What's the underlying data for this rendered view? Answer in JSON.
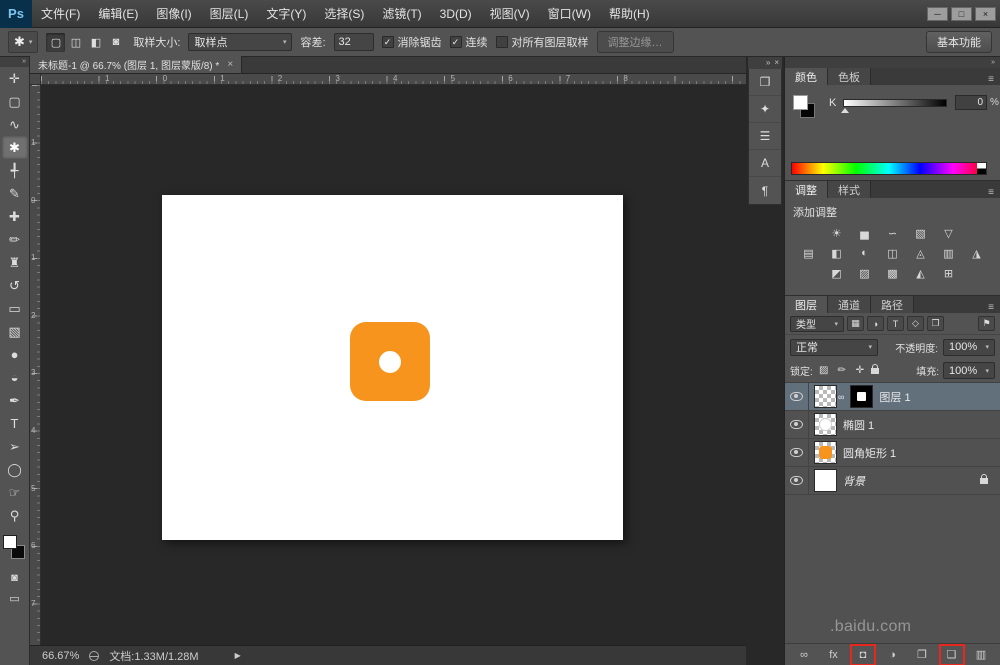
{
  "glyphs": {
    "dropdown": "▾",
    "check": "✓",
    "collapse": "»",
    "close": "×",
    "menu": "≡",
    "link": "∞",
    "arrow": "▶"
  },
  "colors": {
    "accent": "#f7941d",
    "selected_layer": "#62707c"
  },
  "menu_bar": {
    "logo": "Ps",
    "items": [
      "文件(F)",
      "编辑(E)",
      "图像(I)",
      "图层(L)",
      "文字(Y)",
      "选择(S)",
      "滤镜(T)",
      "3D(D)",
      "视图(V)",
      "窗口(W)",
      "帮助(H)"
    ],
    "minimize": "─",
    "maximize": "□",
    "close": "×"
  },
  "options_bar": {
    "tool_glyph": "✱",
    "mode_icons": [
      "▢",
      "◫",
      "◧",
      "◙"
    ],
    "sample_size_label": "取样大小:",
    "sample_size_value": "取样点",
    "tolerance_label": "容差:",
    "tolerance_value": "32",
    "anti_alias_label": "消除锯齿",
    "contiguous_label": "连续",
    "sample_all_label": "对所有图层取样",
    "refine_edge_label": "调整边缘…",
    "workspace_label": "基本功能"
  },
  "document_tab": {
    "title": "未标题-1 @ 66.7% (图层 1, 图层蒙版/8) *"
  },
  "toolbar": {
    "quick_mask_glyph": "◙",
    "screen_mode_glyph": "▭",
    "tools": [
      {
        "name": "move",
        "glyph": "✛",
        "selected": false
      },
      {
        "name": "marquee",
        "glyph": "▢",
        "selected": false
      },
      {
        "name": "lasso",
        "glyph": "∿",
        "selected": false
      },
      {
        "name": "magic-wand",
        "glyph": "✱",
        "selected": true
      },
      {
        "name": "crop",
        "glyph": "╃",
        "selected": false
      },
      {
        "name": "eyedropper",
        "glyph": "✎",
        "selected": false
      },
      {
        "name": "healing-brush",
        "glyph": "✚",
        "selected": false
      },
      {
        "name": "brush",
        "glyph": "✏",
        "selected": false
      },
      {
        "name": "clone-stamp",
        "glyph": "♜",
        "selected": false
      },
      {
        "name": "history-brush",
        "glyph": "↺",
        "selected": false
      },
      {
        "name": "eraser",
        "glyph": "▭",
        "selected": false
      },
      {
        "name": "gradient",
        "glyph": "▧",
        "selected": false
      },
      {
        "name": "blur",
        "glyph": "●",
        "selected": false
      },
      {
        "name": "dodge",
        "glyph": "◒",
        "selected": false
      },
      {
        "name": "pen",
        "glyph": "✒",
        "selected": false
      },
      {
        "name": "type",
        "glyph": "T",
        "selected": false
      },
      {
        "name": "path-selection",
        "glyph": "➢",
        "selected": false
      },
      {
        "name": "ellipse-shape",
        "glyph": "◯",
        "selected": false
      },
      {
        "name": "hand",
        "glyph": "☞",
        "selected": false
      },
      {
        "name": "zoom",
        "glyph": "⚲",
        "selected": false
      }
    ]
  },
  "rulers": {
    "top": [
      "1",
      "0",
      "1",
      "2",
      "3",
      "4",
      "5",
      "6",
      "7",
      "8"
    ],
    "left": [
      "1",
      "0",
      "1",
      "2",
      "3",
      "4",
      "5",
      "6",
      "7"
    ]
  },
  "mini_dock": {
    "icons": [
      {
        "name": "brush-presets",
        "glyph": "❐"
      },
      {
        "name": "brush-panel",
        "glyph": "✦"
      },
      {
        "name": "clone-source",
        "glyph": "☰"
      },
      {
        "name": "character-panel",
        "glyph": "A"
      },
      {
        "name": "paragraph-panel",
        "glyph": "¶"
      }
    ]
  },
  "color_panel": {
    "tab_color": "颜色",
    "tab_swatches": "色板",
    "channel_label": "K",
    "value": "0",
    "unit": "%"
  },
  "adjustments_panel": {
    "tab_adjustments": "调整",
    "tab_styles": "样式",
    "add_label": "添加调整",
    "rows": [
      [
        "☀",
        "▅",
        "∽",
        "▧",
        "▽"
      ],
      [
        "▤",
        "◧",
        "◐",
        "◫",
        "◬",
        "▥",
        "◮"
      ],
      [
        "◩",
        "▨",
        "▩",
        "◭",
        "⊞"
      ]
    ]
  },
  "layers_panel": {
    "tab_layers": "图层",
    "tab_channels": "通道",
    "tab_paths": "路径",
    "filter_label": "类型",
    "filter_icons": [
      "▦",
      "◑",
      "T",
      "◇",
      "❐"
    ],
    "filter_toggle_glyph": "⚑",
    "blend_mode": "正常",
    "opacity_label": "不透明度:",
    "opacity_value": "100%",
    "lock_label": "锁定:",
    "lock_icons": [
      "▨",
      "✏",
      "✛"
    ],
    "fill_label": "填充:",
    "fill_value": "100%",
    "layers": [
      {
        "name": "图层 1"
      },
      {
        "name": "椭圆 1"
      },
      {
        "name": "圆角矩形 1"
      },
      {
        "name": "背景"
      }
    ],
    "footer_icons": [
      {
        "name": "link-layers",
        "glyph": "∞",
        "highlight": false
      },
      {
        "name": "layer-style",
        "glyph": "fx",
        "highlight": false
      },
      {
        "name": "add-layer-mask",
        "glyph": "◘",
        "highlight": true
      },
      {
        "name": "adjustment-layer",
        "glyph": "◑",
        "highlight": false
      },
      {
        "name": "new-group",
        "glyph": "❐",
        "highlight": false
      },
      {
        "name": "new-layer",
        "glyph": "❏",
        "highlight": true
      },
      {
        "name": "delete-layer",
        "glyph": "▥",
        "highlight": false
      }
    ]
  },
  "status_bar": {
    "zoom": "66.67%",
    "doc_label": "文档:1.33M/1.28M"
  },
  "watermark": {
    "text": ".baidu.com"
  }
}
